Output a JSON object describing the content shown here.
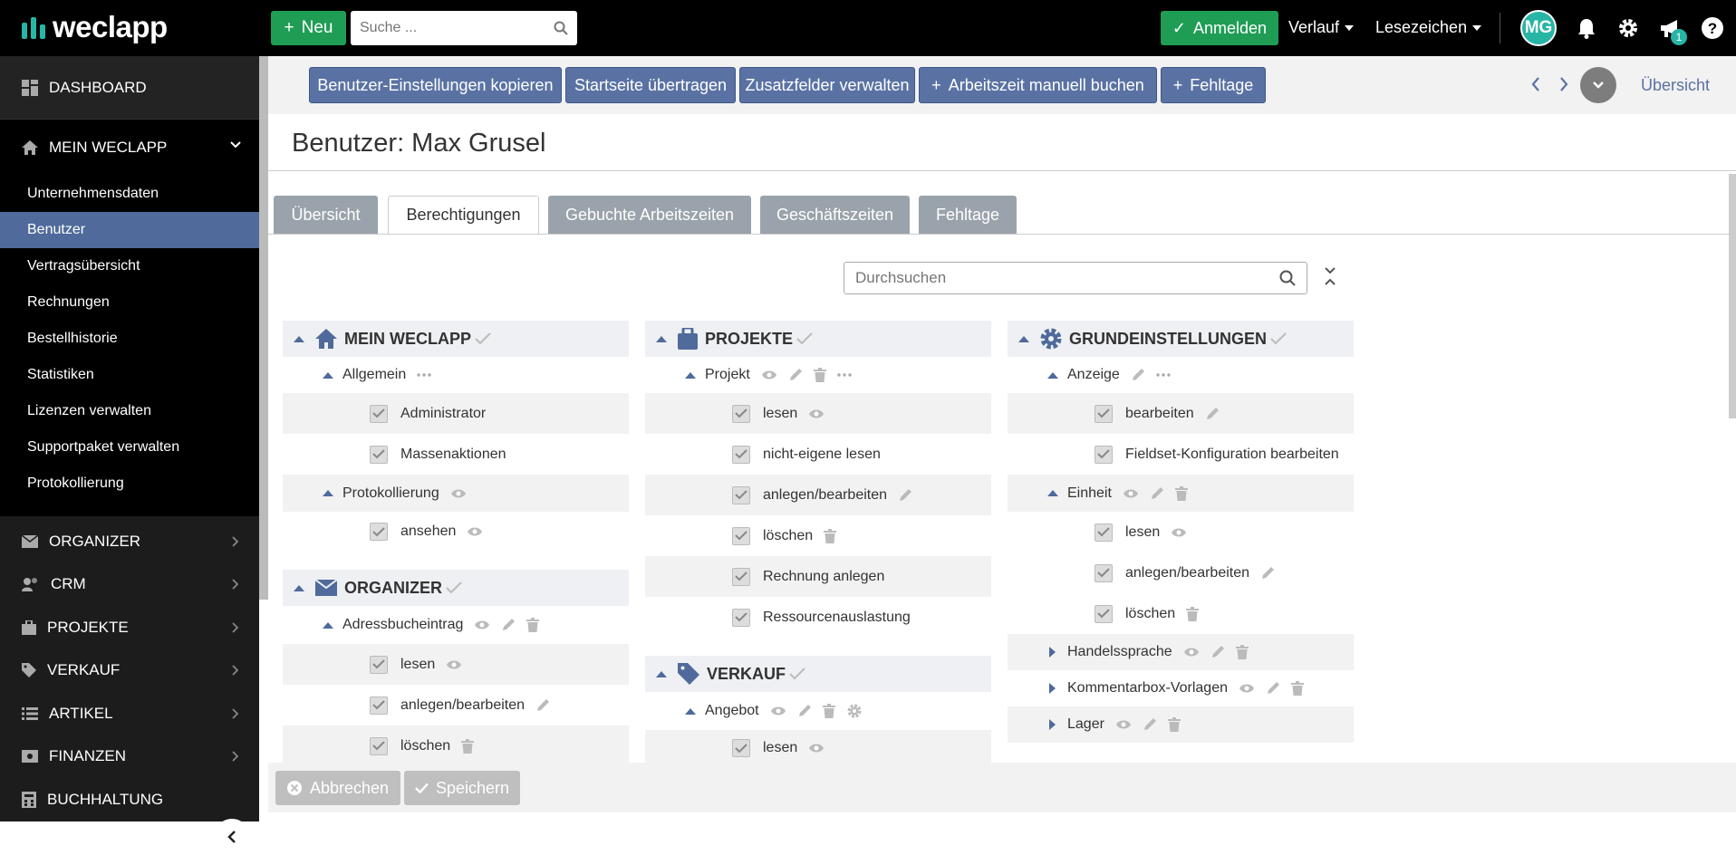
{
  "app": {
    "brand": "weclapp",
    "accent": "#1f9d55",
    "primary": "#5a72a3"
  },
  "topbar": {
    "new_label": "Neu",
    "search_placeholder": "Suche ...",
    "anmelden_label": "Anmelden",
    "verlauf_label": "Verlauf",
    "lesezeichen_label": "Lesezeichen",
    "avatar_initials": "MG",
    "notification_count": "1"
  },
  "sidebar": {
    "dashboard": "DASHBOARD",
    "mein_weclapp": "MEIN WECLAPP",
    "sub_items": [
      "Unternehmensdaten",
      "Benutzer",
      "Vertragsübersicht",
      "Rechnungen",
      "Bestellhistorie",
      "Statistiken",
      "Lizenzen verwalten",
      "Supportpaket verwalten",
      "Protokollierung"
    ],
    "sections": [
      "ORGANIZER",
      "CRM",
      "PROJEKTE",
      "VERKAUF",
      "ARTIKEL",
      "FINANZEN",
      "BUCHHALTUNG"
    ]
  },
  "actions": {
    "copy_settings": "Benutzer-Einstellungen kopieren",
    "startpage": "Startseite übertragen",
    "extra_fields": "Zusatzfelder verwalten",
    "worktime": "Arbeitszeit manuell buchen",
    "absence": "Fehltage",
    "overview_link": "Übersicht"
  },
  "page": {
    "title": "Benutzer: Max Grusel"
  },
  "tabs": [
    "Übersicht",
    "Berechtigungen",
    "Gebuchte Arbeitszeiten",
    "Geschäftszeiten",
    "Fehltage"
  ],
  "perm_search_placeholder": "Durchsuchen",
  "col1": {
    "sec1": "MEIN WECLAPP",
    "allgemein": "Allgemein",
    "administrator": "Administrator",
    "massenaktionen": "Massenaktionen",
    "protokollierung": "Protokollierung",
    "ansehen": "ansehen",
    "sec2": "ORGANIZER",
    "adressbuch": "Adressbucheintrag",
    "lesen": "lesen",
    "anlegen": "anlegen/bearbeiten",
    "loeschen": "löschen"
  },
  "col2": {
    "sec1": "PROJEKTE",
    "projekt": "Projekt",
    "lesen": "lesen",
    "nicht_eigene": "nicht-eigene lesen",
    "anlegen": "anlegen/bearbeiten",
    "loeschen": "löschen",
    "rechnung": "Rechnung anlegen",
    "ressourcen": "Ressourcenauslastung",
    "sec2": "VERKAUF",
    "angebot": "Angebot",
    "lesen2": "lesen"
  },
  "col3": {
    "sec1": "GRUNDEINSTELLUNGEN",
    "anzeige": "Anzeige",
    "bearbeiten": "bearbeiten",
    "fieldset": "Fieldset-Konfiguration bearbeiten",
    "einheit": "Einheit",
    "lesen": "lesen",
    "anlegen": "anlegen/bearbeiten",
    "loeschen": "löschen",
    "handelssprache": "Handelssprache",
    "kommentarbox": "Kommentarbox-Vorlagen",
    "lager": "Lager"
  },
  "footer": {
    "cancel": "Abbrechen",
    "save": "Speichern"
  }
}
